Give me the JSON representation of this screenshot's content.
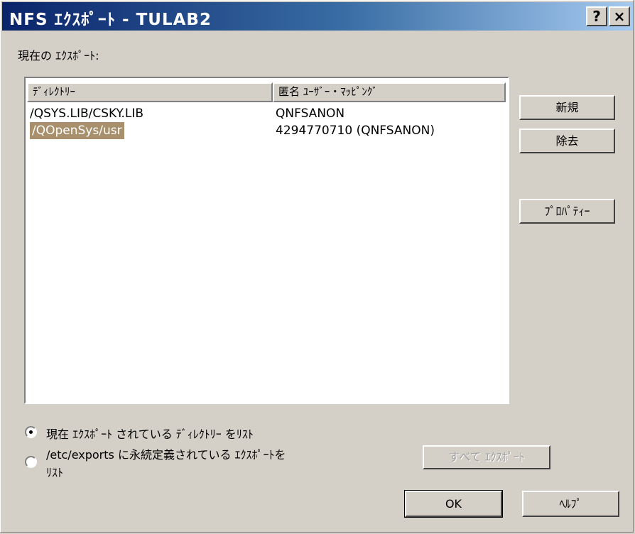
{
  "window": {
    "title": "NFS ｴｸｽﾎﾟｰﾄ - TULAB2",
    "help_button": "?",
    "close_button": "×"
  },
  "current_exports_label": "現在の ｴｸｽﾎﾟｰﾄ:",
  "table": {
    "columns": [
      "ﾃﾞｨﾚｸﾄﾘｰ",
      "匿名 ﾕｰｻﾞｰ・ﾏｯﾋﾟﾝｸﾞ"
    ],
    "rows": [
      {
        "directory": "/QSYS.LIB/CSKY.LIB",
        "mapping": "QNFSANON",
        "selected": false
      },
      {
        "directory": "/QOpenSys/usr",
        "mapping": "4294770710 (QNFSANON)",
        "selected": true
      }
    ]
  },
  "buttons": {
    "new": "新規",
    "remove": "除去",
    "properties": "ﾌﾟﾛﾊﾟﾃｨｰ",
    "export_all": "すべて ｴｸｽﾎﾟｰﾄ",
    "ok": "OK",
    "help": "ﾍﾙﾌﾟ"
  },
  "radios": {
    "current": {
      "label": "現在 ｴｸｽﾎﾟｰﾄ されている ﾃﾞｨﾚｸﾄﾘｰ をﾘｽﾄ",
      "checked": true
    },
    "persistent": {
      "label_line1": "/etc/exports に永続定義されている ｴｸｽﾎﾟｰﾄを",
      "label_line2": "ﾘｽﾄ",
      "checked": false
    }
  }
}
